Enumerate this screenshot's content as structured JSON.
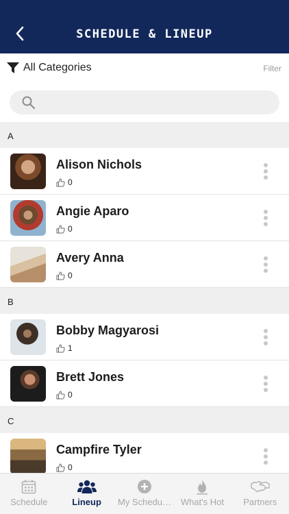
{
  "header": {
    "title": "SCHEDULE & LINEUP",
    "back_icon": "chevron-left-icon"
  },
  "filter_bar": {
    "category": "All Categories",
    "filter_label": "Filter"
  },
  "search": {
    "placeholder": ""
  },
  "sections": [
    {
      "letter": "A",
      "artists": [
        {
          "name": "Alison Nichols",
          "likes": "0"
        },
        {
          "name": "Angie Aparo",
          "likes": "0"
        },
        {
          "name": "Avery Anna",
          "likes": "0"
        }
      ]
    },
    {
      "letter": "B",
      "artists": [
        {
          "name": "Bobby Magyarosi",
          "likes": "1"
        },
        {
          "name": "Brett Jones",
          "likes": "0"
        }
      ]
    },
    {
      "letter": "C",
      "artists": [
        {
          "name": "Campfire Tyler",
          "likes": "0"
        }
      ]
    }
  ],
  "tabs": [
    {
      "label": "Schedule",
      "icon": "calendar-icon",
      "active": false
    },
    {
      "label": "Lineup",
      "icon": "people-icon",
      "active": true
    },
    {
      "label": "My Schedu…",
      "icon": "plus-circle-icon",
      "active": false
    },
    {
      "label": "What's Hot",
      "icon": "flame-icon",
      "active": false
    },
    {
      "label": "Partners",
      "icon": "handshake-icon",
      "active": false
    }
  ],
  "colors": {
    "header": "#13285a",
    "active_tab": "#13285a",
    "inactive": "#a7a7a7"
  }
}
